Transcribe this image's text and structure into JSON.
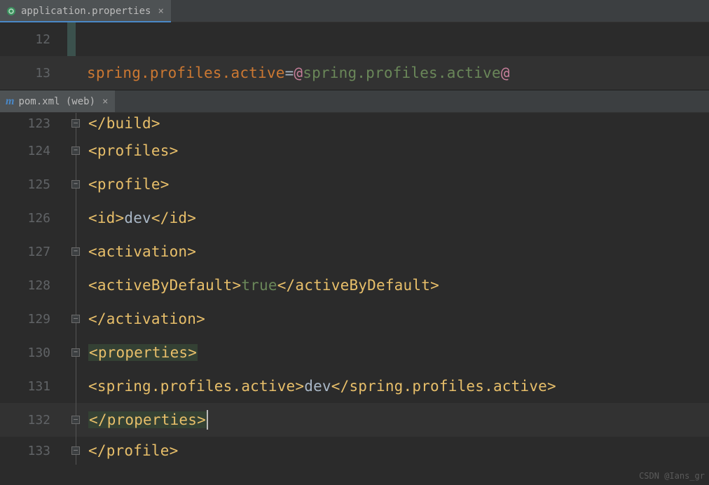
{
  "tab1": {
    "label": "application.properties"
  },
  "tab2": {
    "label": "pom.xml (web)"
  },
  "editor1": {
    "lines": [
      "12",
      "13"
    ],
    "l13": {
      "key": "spring.profiles.active",
      "eq": "=",
      "at1": "@",
      "val": "spring.profiles.active",
      "at2": "@"
    }
  },
  "editor2": {
    "lines": [
      "123",
      "124",
      "125",
      "126",
      "127",
      "128",
      "129",
      "130",
      "131",
      "132",
      "133"
    ],
    "l123": {
      "t1": "</",
      "t2": "build",
      "t3": ">"
    },
    "l124": {
      "t1": "<",
      "t2": "profiles",
      "t3": ">"
    },
    "l125": {
      "t1": "<",
      "t2": "profile",
      "t3": ">"
    },
    "l126": {
      "t1": "<",
      "t2": "id",
      "t3": ">",
      "v": "dev",
      "t4": "</",
      "t5": "id",
      "t6": ">"
    },
    "l127": {
      "t1": "<",
      "t2": "activation",
      "t3": ">"
    },
    "l128": {
      "t1": "<",
      "t2": "activeByDefault",
      "t3": ">",
      "v": "true",
      "t4": "</",
      "t5": "activeByDefault",
      "t6": ">"
    },
    "l129": {
      "t1": "</",
      "t2": "activation",
      "t3": ">"
    },
    "l130": {
      "t1": "<",
      "t2": "properties",
      "t3": ">"
    },
    "l131": {
      "t1": "<",
      "t2": "spring.profiles.active",
      "t3": ">",
      "v": "dev",
      "t4": "</",
      "t5": "spring.profiles.active",
      "t6": ">"
    },
    "l132": {
      "t1": "</",
      "t2": "properties",
      "t3": ">"
    },
    "l133": {
      "t1": "</",
      "t2": "profile",
      "t3": ">"
    }
  },
  "watermark": "CSDN @Ians_gr"
}
